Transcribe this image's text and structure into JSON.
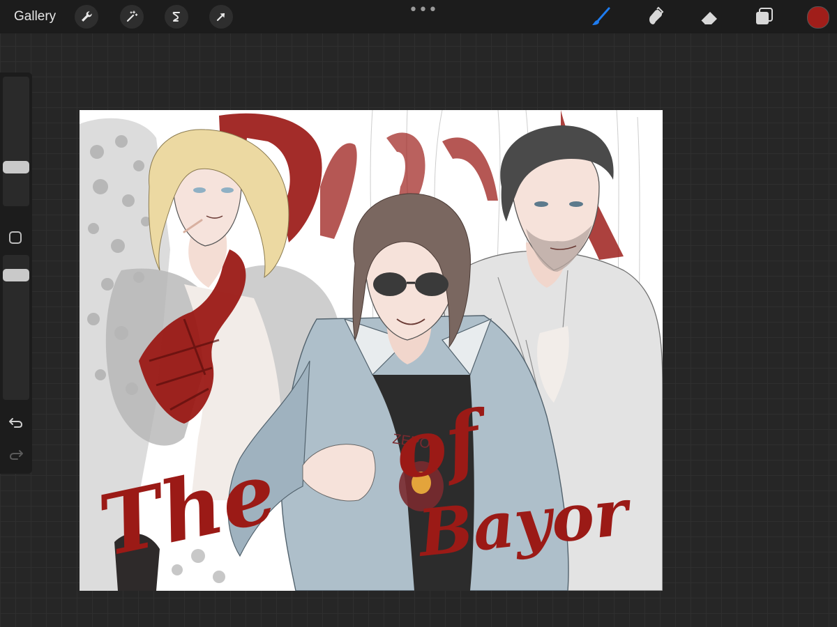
{
  "toolbar": {
    "gallery_label": "Gallery",
    "left_tools": [
      {
        "icon": "wrench-icon",
        "name": "Actions"
      },
      {
        "icon": "magic-wand-icon",
        "name": "Adjustments"
      },
      {
        "icon": "selection-icon",
        "name": "Selection"
      },
      {
        "icon": "arrow-cursor-icon",
        "name": "Transform"
      }
    ],
    "more_label": "•••",
    "right_tools": [
      {
        "icon": "brush-icon",
        "name": "Paint",
        "active": true
      },
      {
        "icon": "smudge-icon",
        "name": "Smudge"
      },
      {
        "icon": "eraser-icon",
        "name": "Erase"
      },
      {
        "icon": "layers-icon",
        "name": "Layers"
      }
    ],
    "active_color": "#a01e1a"
  },
  "sidebar": {
    "brush_size": 0.28,
    "brush_opacity": 1.0,
    "modify_icon": "square-icon",
    "undo_icon": "undo-arrow-icon",
    "redo_icon": "redo-arrow-icon",
    "redo_enabled": false
  },
  "canvas": {
    "background": "#ffffff",
    "lettering": [
      "The",
      "of",
      "Bayor"
    ],
    "shirt_text": "ZEPO"
  },
  "colors": {
    "accent_blue": "#1e7cf0",
    "lettering_red": "#a01e1a",
    "ui_dark": "#1c1c1c"
  }
}
